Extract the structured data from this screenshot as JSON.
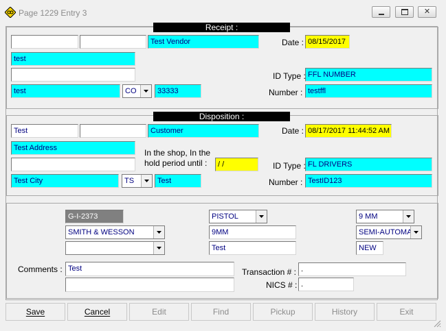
{
  "window": {
    "title": "Page 1229  Entry 3",
    "icon": "diamond-logo-icon",
    "accent": "#f5d400"
  },
  "receipt": {
    "header": "Receipt :",
    "first_name": "",
    "middle_name": "",
    "name_company": "Test Vendor",
    "address": "test",
    "address2": "",
    "city": "test",
    "state": "CO",
    "zip": "33333",
    "date_label": "Date :",
    "date": "08/15/2017",
    "id_type_label": "ID Type :",
    "id_type": "FFL NUMBER",
    "number_label": "Number :",
    "number": "testffl"
  },
  "disposition": {
    "header": "Disposition :",
    "first_name": "Test",
    "middle_name": "",
    "name_company": "Customer",
    "address": "Test Address",
    "address2": "",
    "hold_label_line1": "In the shop, In the",
    "hold_label_line2": "hold period until :",
    "hold_date": " /  /",
    "city": "Test City",
    "state": "TS",
    "zip": "Test",
    "date_label": "Date :",
    "date": "08/17/2017 11:44:52 AM",
    "id_type_label": "ID Type :",
    "id_type": "FL DRIVERS",
    "number_label": "Number :",
    "number": "TestID123"
  },
  "firearm": {
    "stock_number": "G-I-2373",
    "manufacturer": "SMITH & WESSON",
    "importer": "",
    "type": "PISTOL",
    "caliber": "9MM",
    "model": "Test",
    "caliber_combo": "9 MM",
    "action": "SEMI-AUTOMAT",
    "condition": "NEW"
  },
  "notes": {
    "comments_label": "Comments :",
    "comments": "Test",
    "comments2": "",
    "transaction_label": "Transaction # :",
    "transaction": ".",
    "nics_label": "NICS # :",
    "nics": "."
  },
  "buttons": {
    "save": "Save",
    "cancel": "Cancel",
    "edit": "Edit",
    "find": "Find",
    "pickup": "Pickup",
    "history": "History",
    "exit": "Exit"
  }
}
